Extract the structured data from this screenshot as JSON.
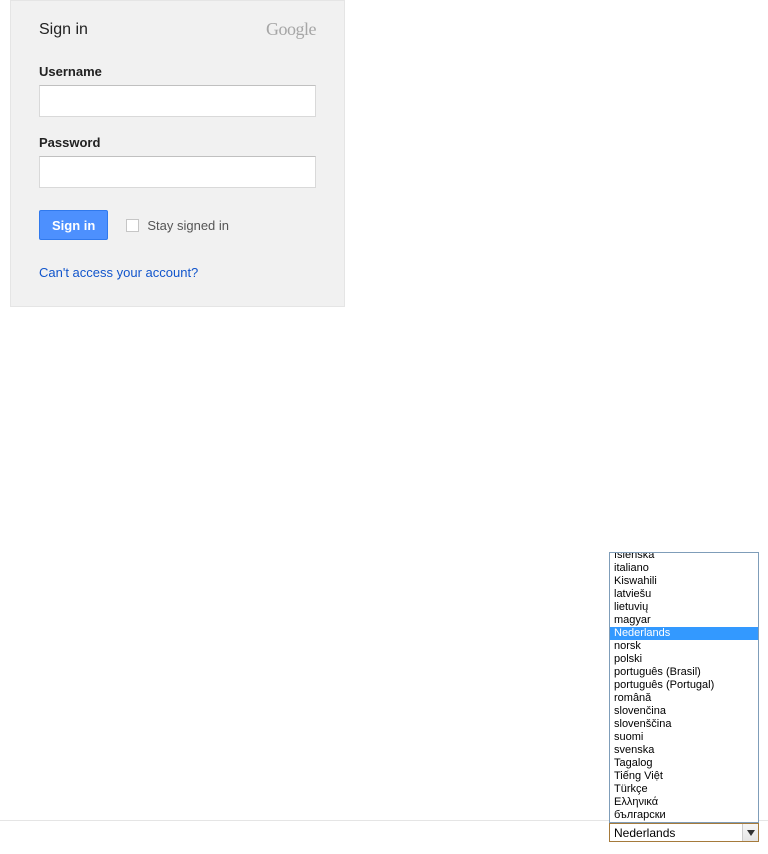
{
  "card": {
    "title": "Sign in",
    "brand": "Google",
    "username_label": "Username",
    "username_value": "",
    "password_label": "Password",
    "password_value": "",
    "signin_button": "Sign in",
    "stay_signed_in_label": "Stay signed in",
    "cant_access_link": "Can't access your account?"
  },
  "language_selector": {
    "selected": "Nederlands",
    "options": [
      "íslenska",
      "italiano",
      "Kiswahili",
      "latviešu",
      "lietuvių",
      "magyar",
      "Nederlands",
      "norsk",
      "polski",
      "português (Brasil)",
      "português (Portugal)",
      "română",
      "slovenčina",
      "slovenščina",
      "suomi",
      "svenska",
      "Tagalog",
      "Tiếng Việt",
      "Türkçe",
      "Ελληνικά",
      "български"
    ]
  }
}
